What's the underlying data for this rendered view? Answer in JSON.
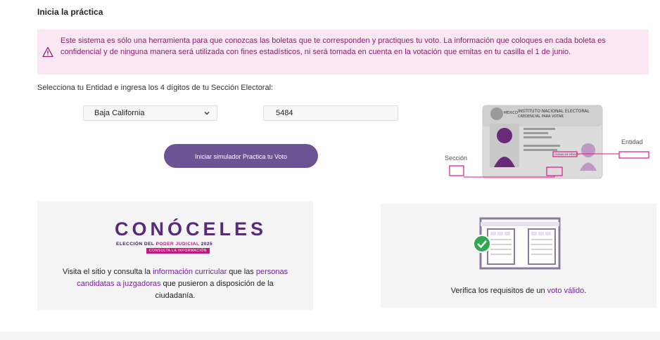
{
  "heading": "Inicia la práctica",
  "alert": {
    "text": "Este sistema es sólo una herramienta para que conozcas las boletas que te corresponden y practiques tu voto. La información que coloques en cada boleta es confidencial y de ninguna manera será utilizada con fines estadísticos, ni será tomada en cuenta en la votación que emitas en tu casilla el 1 de junio."
  },
  "instructions": "Selecciona tu Entidad e ingresa los 4 dígitos de tu Sección Electoral:",
  "entity_select": {
    "value": "Baja California"
  },
  "section_input": {
    "value": "5484"
  },
  "start_button": "Iniciar simulador Practica tu Voto",
  "id_card": {
    "label_seccion": "Sección",
    "label_entidad": "Entidad",
    "country": "MÉXICO",
    "institute": "INSTITUTO NACIONAL ELECTORAL",
    "credential": "CREDENCIAL PARA VOTAR",
    "entidad_value": "CIUDAD DE MÉXICO"
  },
  "card_left": {
    "logo": "CONÓCELES",
    "logo_sub_1": "ELECCIÓN DEL",
    "logo_sub_2": "PODER JUDICIAL",
    "logo_sub_3": "2025",
    "logo_tag": "CONSULTA LA INFORMACIÓN",
    "text_1": "Visita el sitio y consulta la ",
    "link_1": "información curricular",
    "text_2": " que las ",
    "link_2": "personas candidatas a juzgadoras",
    "text_3": " que pusieron a disposición de la ciudadanía."
  },
  "card_right": {
    "text_1": "Verifica los requisitos de un ",
    "link_1": "voto válido",
    "text_2": "."
  },
  "colors": {
    "accent": "#6b5494",
    "alert_bg": "#fbe7f3",
    "alert_text": "#8b1f6e",
    "link": "#7b1fa2",
    "magenta": "#e0168a"
  }
}
